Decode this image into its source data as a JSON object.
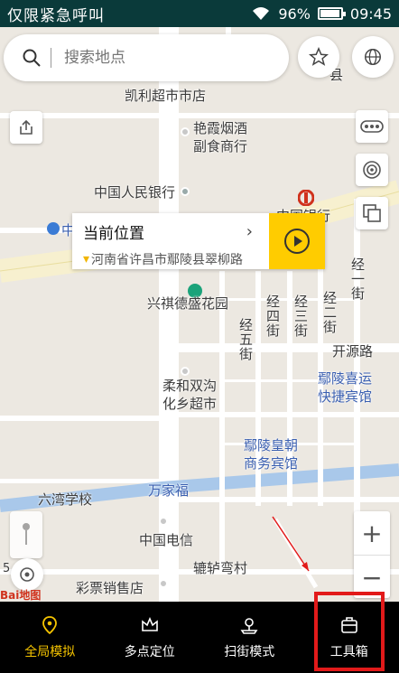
{
  "statusbar": {
    "title": "仅限紧急呼叫",
    "battery": "96%",
    "time": "09:45",
    "battery_level": 0.96
  },
  "search": {
    "placeholder": "搜索地点"
  },
  "location_card": {
    "title": "当前位置",
    "address": "河南省许昌市鄢陵县翠柳路"
  },
  "map_labels": {
    "l1": "凯利超市市店",
    "l2a": "艳霞烟酒",
    "l2b": "副食商行",
    "l3": "中国人民银行",
    "l4": "中国银行",
    "l5": "兴祺德盛花园",
    "l6": "经一街",
    "l7": "经二街",
    "l8": "经三街",
    "l9": "经四街",
    "l10": "经五街",
    "l11": "开源路",
    "l12a": "鄢陵喜运",
    "l12b": "快捷宾馆",
    "l13a": "柔和双沟",
    "l13b": "化乡超市",
    "l14a": "鄢陵皇朝",
    "l14b": "商务宾馆",
    "l15": "万家福",
    "l16": "六湾学校",
    "l17": "中国电信",
    "l18": "辘轳弯村",
    "l19": "彩票销售店",
    "l20": "县",
    "l21": "中",
    "scale": "5"
  },
  "logo": "Bai地图",
  "tabs": [
    {
      "label": "全局模拟",
      "icon": "location-pin-icon",
      "active": true
    },
    {
      "label": "多点定位",
      "icon": "crown-icon",
      "active": false
    },
    {
      "label": "扫街模式",
      "icon": "map-pin-icon",
      "active": false
    },
    {
      "label": "工具箱",
      "icon": "toolbox-icon",
      "active": false
    }
  ],
  "colors": {
    "accent": "#f5c400",
    "highlight": "#e21a1a",
    "statusbar": "#0a3a3a"
  }
}
